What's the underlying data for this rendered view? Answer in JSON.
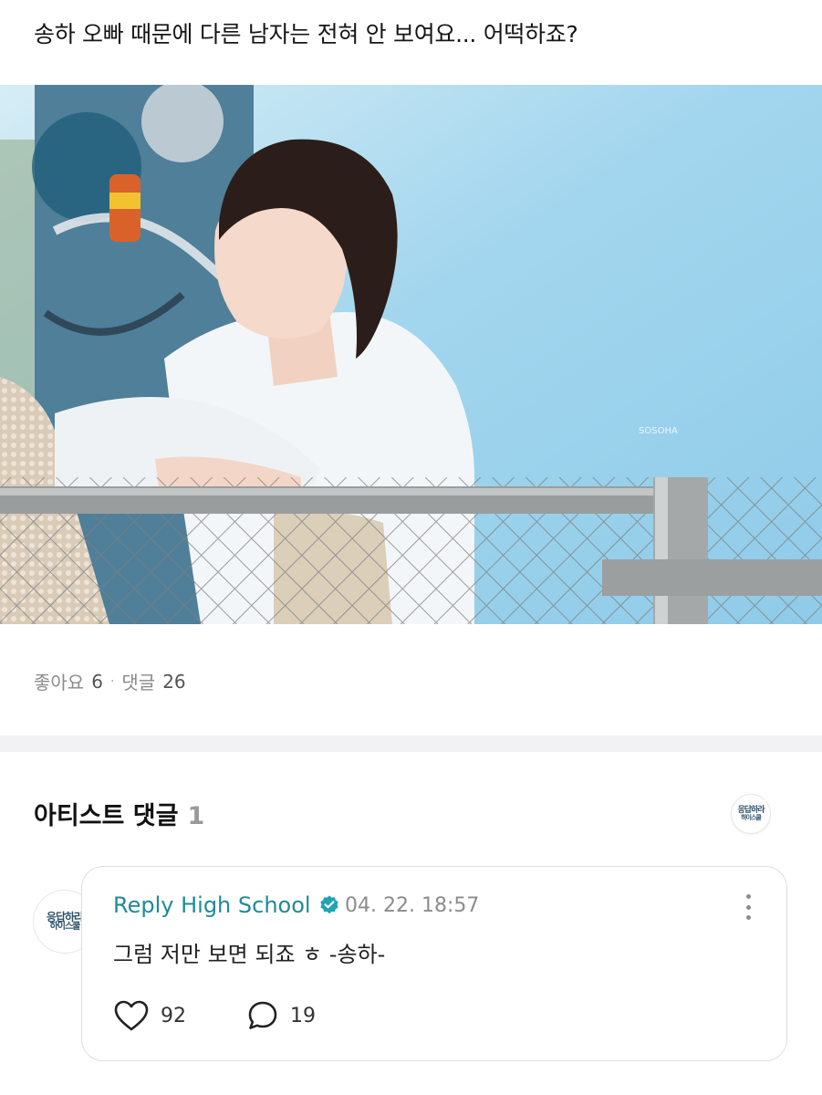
{
  "post": {
    "title": "송하 오빠 때문에 다른 남자는 전혀 안 보여요... 어떡하죠?",
    "image_icon": "photo-of-artist",
    "likes_label": "좋아요",
    "likes_count": "6",
    "comments_label": "댓글",
    "comments_count": "26",
    "separator": "·"
  },
  "artist_section": {
    "title": "아티스트 댓글",
    "count": "1",
    "logo_line1": "응답하라",
    "logo_line2": "하이스쿨"
  },
  "comment": {
    "author": "Reply High School",
    "verified_icon": "verified-badge-icon",
    "timestamp": "04. 22. 18:57",
    "text": "그럼 저만 보면 되죠 ㅎ  -송하-",
    "like_count": "92",
    "reply_count": "19",
    "avatar_line1": "응답하라",
    "avatar_line2": "하이스쿨"
  },
  "colors": {
    "author": "#1f8a96",
    "verified": "#1fa3b5",
    "muted": "#8c8c8c",
    "divider": "#f2f2f4"
  }
}
